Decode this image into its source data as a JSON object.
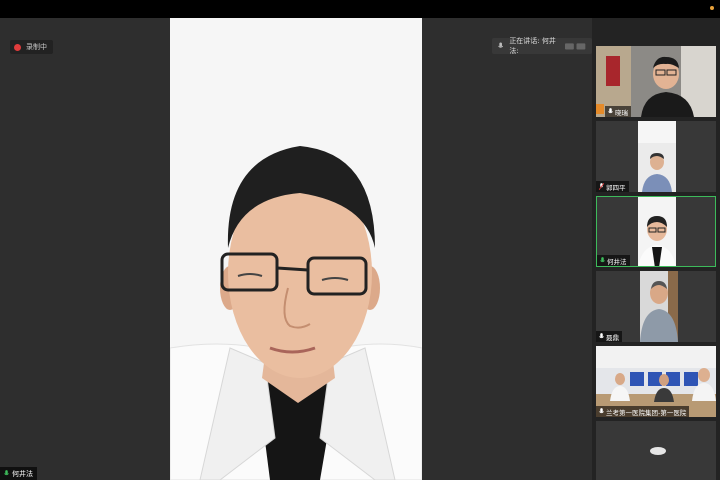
{
  "recording": {
    "label": "录制中"
  },
  "speaking": {
    "label": "正在讲话: 何井法:"
  },
  "main_video": {
    "name": "何井法"
  },
  "participants": [
    {
      "name": "晓瑞"
    },
    {
      "name": "郭四平"
    },
    {
      "name": "何井法"
    },
    {
      "name": "聂鼎"
    },
    {
      "name": "兰考第一医院集团-第一医院"
    },
    {
      "name": ""
    }
  ],
  "colors": {
    "active_border": "#3dbb5b",
    "recording_dot": "#e03c3c",
    "background": "#2b2b2b"
  }
}
